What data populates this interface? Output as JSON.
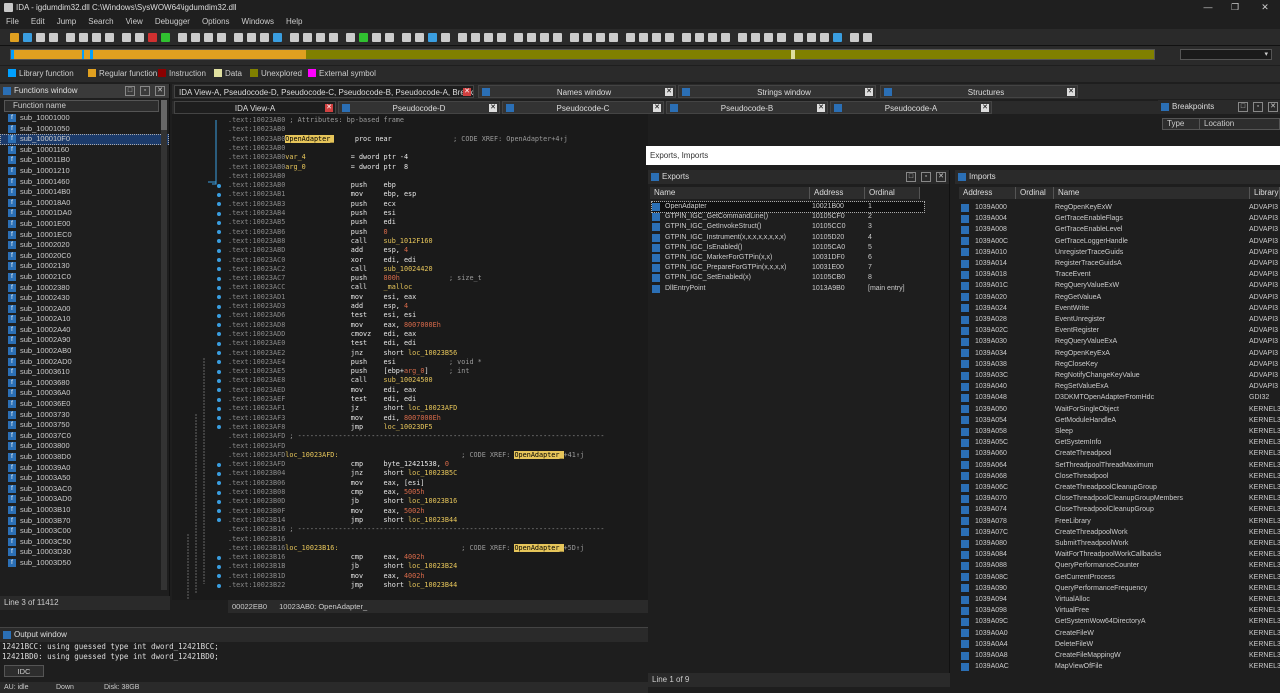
{
  "window": {
    "title": "IDA - igdumdim32.dll C:\\Windows\\SysWOW64\\igdumdim32.dll"
  },
  "menu": [
    "File",
    "Edit",
    "Jump",
    "Search",
    "View",
    "Debugger",
    "Options",
    "Windows",
    "Help"
  ],
  "legend": [
    {
      "label": "Library function",
      "color": "#00a0ff"
    },
    {
      "label": "Regular function",
      "color": "#e0a020"
    },
    {
      "label": "Instruction",
      "color": "#8b0000"
    },
    {
      "label": "Data",
      "color": "#e0e0a0"
    },
    {
      "label": "Unexplored",
      "color": "#808000"
    },
    {
      "label": "External symbol",
      "color": "#ff00ff"
    }
  ],
  "functions": {
    "title": "Functions window",
    "column": "Function name",
    "items": [
      "sub_10001000",
      "sub_10001050",
      "sub_100010F0",
      "sub_10001160",
      "sub_100011B0",
      "sub_10001210",
      "sub_10001460",
      "sub_100014B0",
      "sub_100018A0",
      "sub_10001DA0",
      "sub_10001E00",
      "sub_10001EC0",
      "sub_10002020",
      "sub_100020C0",
      "sub_10002130",
      "sub_100021C0",
      "sub_10002380",
      "sub_10002430",
      "sub_10002A00",
      "sub_10002A10",
      "sub_10002A40",
      "sub_10002A90",
      "sub_10002AB0",
      "sub_10002AD0",
      "sub_10003610",
      "sub_10003680",
      "sub_100036A0",
      "sub_100036E0",
      "sub_10003730",
      "sub_10003750",
      "sub_100037C0",
      "sub_10003800",
      "sub_100038D0",
      "sub_100039A0",
      "sub_10003A50",
      "sub_10003AC0",
      "sub_10003AD0",
      "sub_10003B10",
      "sub_10003B70",
      "sub_10003C00",
      "sub_10003C50",
      "sub_10003D30",
      "sub_10003D50"
    ],
    "selected_index": 2,
    "status": "Line 3 of 11412"
  },
  "tabs": {
    "main": [
      {
        "label": "IDA View-A, Pseudocode-D, Pseudocode-C, Pseudocode-B, Pseudocode-A, Breakpoints"
      },
      {
        "label": "Names window"
      },
      {
        "label": "Strings window"
      },
      {
        "label": "Structures"
      }
    ],
    "sub": [
      "IDA View-A",
      "Pseudocode-D",
      "Pseudocode-C",
      "Pseudocode-B",
      "Pseudocode-A"
    ],
    "breakpoints": {
      "title": "Breakpoints",
      "cols": [
        "Type",
        "Location"
      ]
    }
  },
  "code": [
    {
      "a": ".text:10023AB0",
      "rest": [
        [
          "cmt",
          " ; Attributes: bp-based frame"
        ]
      ]
    },
    {
      "a": ".text:10023AB0",
      "rest": []
    },
    {
      "a": ".text:10023AB0",
      "rest": [
        [
          "hl",
          "OpenAdapter_"
        ],
        [
          "mn",
          "     proc near"
        ],
        [
          "cmt",
          "               ; CODE XREF: OpenAdapter+4↑j"
        ]
      ]
    },
    {
      "a": ".text:10023AB0",
      "rest": []
    },
    {
      "a": ".text:10023AB0",
      "rest": [
        [
          "lbl",
          "var_4"
        ],
        [
          "mn",
          "           = dword ptr -4"
        ]
      ]
    },
    {
      "a": ".text:10023AB0",
      "rest": [
        [
          "lbl",
          "arg_0"
        ],
        [
          "mn",
          "           = dword ptr  8"
        ]
      ]
    },
    {
      "a": ".text:10023AB0",
      "rest": []
    },
    {
      "a": ".text:10023AB0",
      "rest": [
        [
          "mn",
          "                push    ebp"
        ]
      ]
    },
    {
      "a": ".text:10023AB1",
      "rest": [
        [
          "mn",
          "                mov     ebp, esp"
        ]
      ]
    },
    {
      "a": ".text:10023AB3",
      "rest": [
        [
          "mn",
          "                push    ecx"
        ]
      ]
    },
    {
      "a": ".text:10023AB4",
      "rest": [
        [
          "mn",
          "                push    esi"
        ]
      ]
    },
    {
      "a": ".text:10023AB5",
      "rest": [
        [
          "mn",
          "                push    edi"
        ]
      ]
    },
    {
      "a": ".text:10023AB6",
      "rest": [
        [
          "mn",
          "                push    "
        ],
        [
          "num",
          "0"
        ]
      ]
    },
    {
      "a": ".text:10023AB8",
      "rest": [
        [
          "mn",
          "                call    "
        ],
        [
          "lbl",
          "sub_1012F160"
        ]
      ]
    },
    {
      "a": ".text:10023ABD",
      "rest": [
        [
          "mn",
          "                add     esp, "
        ],
        [
          "num",
          "4"
        ]
      ]
    },
    {
      "a": ".text:10023AC0",
      "rest": [
        [
          "mn",
          "                xor     edi, edi"
        ]
      ]
    },
    {
      "a": ".text:10023AC2",
      "rest": [
        [
          "mn",
          "                call    "
        ],
        [
          "lbl",
          "sub_10024420"
        ]
      ]
    },
    {
      "a": ".text:10023AC7",
      "rest": [
        [
          "mn",
          "                push    "
        ],
        [
          "num",
          "800h"
        ],
        [
          "cmt",
          "            ; size_t"
        ]
      ]
    },
    {
      "a": ".text:10023ACC",
      "rest": [
        [
          "mn",
          "                call    "
        ],
        [
          "lbl",
          "_malloc"
        ]
      ]
    },
    {
      "a": ".text:10023AD1",
      "rest": [
        [
          "mn",
          "                mov     esi, eax"
        ]
      ]
    },
    {
      "a": ".text:10023AD3",
      "rest": [
        [
          "mn",
          "                add     esp, "
        ],
        [
          "num",
          "4"
        ]
      ]
    },
    {
      "a": ".text:10023AD6",
      "rest": [
        [
          "mn",
          "                test    esi, esi"
        ]
      ]
    },
    {
      "a": ".text:10023AD8",
      "rest": [
        [
          "mn",
          "                mov     eax, "
        ],
        [
          "num",
          "8007000Eh"
        ]
      ]
    },
    {
      "a": ".text:10023ADD",
      "rest": [
        [
          "mn",
          "                cmovz   edi, eax"
        ]
      ]
    },
    {
      "a": ".text:10023AE0",
      "rest": [
        [
          "mn",
          "                test    edi, edi"
        ]
      ]
    },
    {
      "a": ".text:10023AE2",
      "rest": [
        [
          "mn",
          "                jnz     short "
        ],
        [
          "lbl",
          "loc_10023B56"
        ]
      ]
    },
    {
      "a": ".text:10023AE4",
      "rest": [
        [
          "mn",
          "                push    esi"
        ],
        [
          "cmt",
          "             ; void *"
        ]
      ]
    },
    {
      "a": ".text:10023AE5",
      "rest": [
        [
          "mn",
          "                push    [ebp+"
        ],
        [
          "num",
          "arg_0"
        ],
        [
          "mn",
          "]"
        ],
        [
          "cmt",
          "     ; int"
        ]
      ]
    },
    {
      "a": ".text:10023AE8",
      "rest": [
        [
          "mn",
          "                call    "
        ],
        [
          "lbl",
          "sub_10024500"
        ]
      ]
    },
    {
      "a": ".text:10023AED",
      "rest": [
        [
          "mn",
          "                mov     edi, eax"
        ]
      ]
    },
    {
      "a": ".text:10023AEF",
      "rest": [
        [
          "mn",
          "                test    edi, edi"
        ]
      ]
    },
    {
      "a": ".text:10023AF1",
      "rest": [
        [
          "mn",
          "                jz      short "
        ],
        [
          "lbl",
          "loc_10023AFD"
        ]
      ]
    },
    {
      "a": ".text:10023AF3",
      "rest": [
        [
          "mn",
          "                mov     edi, "
        ],
        [
          "num",
          "8007000Eh"
        ]
      ]
    },
    {
      "a": ".text:10023AF8",
      "rest": [
        [
          "mn",
          "                jmp     "
        ],
        [
          "lbl",
          "loc_10023DF5"
        ]
      ]
    },
    {
      "a": ".text:10023AFD",
      "rest": [
        [
          "cmt",
          " ; ---------------------------------------------------------------------------"
        ]
      ]
    },
    {
      "a": ".text:10023AFD",
      "rest": []
    },
    {
      "a": ".text:10023AFD",
      "rest": [
        [
          "lbl",
          "loc_10023AFD:"
        ],
        [
          "cmt",
          "                              ; CODE XREF: "
        ],
        [
          "hl",
          "OpenAdapter_"
        ],
        [
          "cmt",
          "+41↑j"
        ]
      ]
    },
    {
      "a": ".text:10023AFD",
      "rest": [
        [
          "mn",
          "                cmp     byte_12421538, "
        ],
        [
          "num",
          "0"
        ]
      ]
    },
    {
      "a": ".text:10023B04",
      "rest": [
        [
          "mn",
          "                jnz     short "
        ],
        [
          "lbl",
          "loc_10023B5C"
        ]
      ]
    },
    {
      "a": ".text:10023B06",
      "rest": [
        [
          "mn",
          "                mov     eax, [esi]"
        ]
      ]
    },
    {
      "a": ".text:10023B08",
      "rest": [
        [
          "mn",
          "                cmp     eax, "
        ],
        [
          "num",
          "5005h"
        ]
      ]
    },
    {
      "a": ".text:10023B0D",
      "rest": [
        [
          "mn",
          "                jb      short "
        ],
        [
          "lbl",
          "loc_10023B16"
        ]
      ]
    },
    {
      "a": ".text:10023B0F",
      "rest": [
        [
          "mn",
          "                mov     eax, "
        ],
        [
          "num",
          "5002h"
        ]
      ]
    },
    {
      "a": ".text:10023B14",
      "rest": [
        [
          "mn",
          "                jmp     short "
        ],
        [
          "lbl",
          "loc_10023B44"
        ]
      ]
    },
    {
      "a": ".text:10023B16",
      "rest": [
        [
          "cmt",
          " ; ---------------------------------------------------------------------------"
        ]
      ]
    },
    {
      "a": ".text:10023B16",
      "rest": []
    },
    {
      "a": ".text:10023B16",
      "rest": [
        [
          "lbl",
          "loc_10023B16:"
        ],
        [
          "cmt",
          "                              ; CODE XREF: "
        ],
        [
          "hl",
          "OpenAdapter_"
        ],
        [
          "cmt",
          "+5D↑j"
        ]
      ]
    },
    {
      "a": ".text:10023B16",
      "rest": [
        [
          "mn",
          "                cmp     eax, "
        ],
        [
          "num",
          "4002h"
        ]
      ]
    },
    {
      "a": ".text:10023B1B",
      "rest": [
        [
          "mn",
          "                jb      short "
        ],
        [
          "lbl",
          "loc_10023B24"
        ]
      ]
    },
    {
      "a": ".text:10023B1D",
      "rest": [
        [
          "mn",
          "                mov     eax, "
        ],
        [
          "num",
          "4002h"
        ]
      ]
    },
    {
      "a": ".text:10023B22",
      "rest": [
        [
          "mn",
          "                jmp     short "
        ],
        [
          "lbl",
          "loc_10023B44"
        ]
      ]
    }
  ],
  "code_status": {
    "offset": "00022EB0",
    "location": "10023AB0: OpenAdapter_"
  },
  "output": {
    "title": "Output window",
    "lines": [
      "12421BCC: using guessed type int dword_12421BCC;",
      "12421BD0: using guessed type int dword_12421BD0;"
    ],
    "idc": "IDC"
  },
  "statusbar": {
    "au": "AU:  idle",
    "dir": "Down",
    "disk": "Disk: 38GB"
  },
  "dialog": {
    "title": "Exports, Imports"
  },
  "exports": {
    "title": "Exports",
    "cols": [
      "Name",
      "Address",
      "Ordinal"
    ],
    "rows": [
      [
        "OpenAdapter",
        "10021B00",
        "1"
      ],
      [
        "GTPIN_IGC_GetCommandLine()",
        "10105CF0",
        "2"
      ],
      [
        "GTPIN_IGC_GetInvokeStruct()",
        "10105CC0",
        "3"
      ],
      [
        "GTPIN_IGC_Instrument(x,x,x,x,x,x,x,x)",
        "10105D20",
        "4"
      ],
      [
        "GTPIN_IGC_IsEnabled()",
        "10105CA0",
        "5"
      ],
      [
        "GTPIN_IGC_MarkerForGTPin(x,x)",
        "10031DF0",
        "6"
      ],
      [
        "GTPIN_IGC_PrepareForGTPin(x,x,x,x)",
        "10031E00",
        "7"
      ],
      [
        "GTPIN_IGC_SetEnabled(x)",
        "10105CB0",
        "8"
      ],
      [
        "DllEntryPoint",
        "1013A9B0",
        "[main entry]"
      ]
    ],
    "status": "Line 1 of 9"
  },
  "imports": {
    "title": "Imports",
    "cols": [
      "Address",
      "Ordinal",
      "Name",
      "Library"
    ],
    "rows": [
      [
        "1039A000",
        "",
        "RegOpenKeyExW",
        "ADVAPI3"
      ],
      [
        "1039A004",
        "",
        "GetTraceEnableFlags",
        "ADVAPI3"
      ],
      [
        "1039A008",
        "",
        "GetTraceEnableLevel",
        "ADVAPI3"
      ],
      [
        "1039A00C",
        "",
        "GetTraceLoggerHandle",
        "ADVAPI3"
      ],
      [
        "1039A010",
        "",
        "UnregisterTraceGuids",
        "ADVAPI3"
      ],
      [
        "1039A014",
        "",
        "RegisterTraceGuidsA",
        "ADVAPI3"
      ],
      [
        "1039A018",
        "",
        "TraceEvent",
        "ADVAPI3"
      ],
      [
        "1039A01C",
        "",
        "RegQueryValueExW",
        "ADVAPI3"
      ],
      [
        "1039A020",
        "",
        "RegGetValueA",
        "ADVAPI3"
      ],
      [
        "1039A024",
        "",
        "EventWrite",
        "ADVAPI3"
      ],
      [
        "1039A028",
        "",
        "EventUnregister",
        "ADVAPI3"
      ],
      [
        "1039A02C",
        "",
        "EventRegister",
        "ADVAPI3"
      ],
      [
        "1039A030",
        "",
        "RegQueryValueExA",
        "ADVAPI3"
      ],
      [
        "1039A034",
        "",
        "RegOpenKeyExA",
        "ADVAPI3"
      ],
      [
        "1039A038",
        "",
        "RegCloseKey",
        "ADVAPI3"
      ],
      [
        "1039A03C",
        "",
        "RegNotifyChangeKeyValue",
        "ADVAPI3"
      ],
      [
        "1039A040",
        "",
        "RegSetValueExA",
        "ADVAPI3"
      ],
      [
        "1039A048",
        "",
        "D3DKMTOpenAdapterFromHdc",
        "GDI32"
      ],
      [
        "1039A050",
        "",
        "WaitForSingleObject",
        "KERNEL3"
      ],
      [
        "1039A054",
        "",
        "GetModuleHandleA",
        "KERNEL3"
      ],
      [
        "1039A058",
        "",
        "Sleep",
        "KERNEL3"
      ],
      [
        "1039A05C",
        "",
        "GetSystemInfo",
        "KERNEL3"
      ],
      [
        "1039A060",
        "",
        "CreateThreadpool",
        "KERNEL3"
      ],
      [
        "1039A064",
        "",
        "SetThreadpoolThreadMaximum",
        "KERNEL3"
      ],
      [
        "1039A068",
        "",
        "CloseThreadpool",
        "KERNEL3"
      ],
      [
        "1039A06C",
        "",
        "CreateThreadpoolCleanupGroup",
        "KERNEL3"
      ],
      [
        "1039A070",
        "",
        "CloseThreadpoolCleanupGroupMembers",
        "KERNEL3"
      ],
      [
        "1039A074",
        "",
        "CloseThreadpoolCleanupGroup",
        "KERNEL3"
      ],
      [
        "1039A078",
        "",
        "FreeLibrary",
        "KERNEL3"
      ],
      [
        "1039A07C",
        "",
        "CreateThreadpoolWork",
        "KERNEL3"
      ],
      [
        "1039A080",
        "",
        "SubmitThreadpoolWork",
        "KERNEL3"
      ],
      [
        "1039A084",
        "",
        "WaitForThreadpoolWorkCallbacks",
        "KERNEL3"
      ],
      [
        "1039A088",
        "",
        "QueryPerformanceCounter",
        "KERNEL3"
      ],
      [
        "1039A08C",
        "",
        "GetCurrentProcess",
        "KERNEL3"
      ],
      [
        "1039A090",
        "",
        "QueryPerformanceFrequency",
        "KERNEL3"
      ],
      [
        "1039A094",
        "",
        "VirtualAlloc",
        "KERNEL3"
      ],
      [
        "1039A098",
        "",
        "VirtualFree",
        "KERNEL3"
      ],
      [
        "1039A09C",
        "",
        "GetSystemWow64DirectoryA",
        "KERNEL3"
      ],
      [
        "1039A0A0",
        "",
        "CreateFileW",
        "KERNEL3"
      ],
      [
        "1039A0A4",
        "",
        "DeleteFileW",
        "KERNEL3"
      ],
      [
        "1039A0A8",
        "",
        "CreateFileMappingW",
        "KERNEL3"
      ],
      [
        "1039A0AC",
        "",
        "MapViewOfFile",
        "KERNEL3"
      ]
    ]
  }
}
